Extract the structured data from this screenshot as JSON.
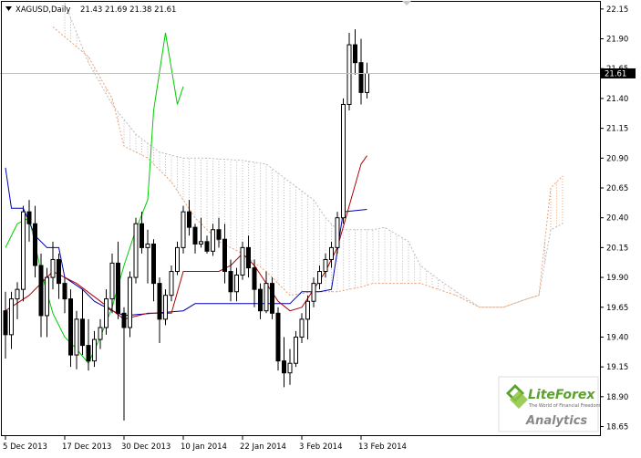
{
  "header": {
    "symbol": "XAGUSD,Daily",
    "ohlc": "21.43 21.69 21.38 21.61"
  },
  "price_label": "21.61",
  "brand": {
    "name": "LiteForex",
    "tagline": "The World of Financial Freedom",
    "product": "Analytics"
  },
  "colors": {
    "bull_candle": "#ffffff",
    "bear_candle": "#000000",
    "tenkan": "#b00000",
    "kijun": "#0000b0",
    "chikou": "#00cc00",
    "span_a": "#f0a070",
    "span_b": "#bbbbbb",
    "brand_green": "#5aa02c",
    "brand_blue": "#1f5fa8"
  },
  "chart_data": {
    "type": "candlestick",
    "title": "XAGUSD,Daily",
    "ylim": [
      18.57,
      22.21
    ],
    "y_ticks": [
      "22.15",
      "21.90",
      "21.65",
      "21.40",
      "21.15",
      "20.90",
      "20.65",
      "20.40",
      "20.15",
      "19.90",
      "19.65",
      "19.40",
      "19.15",
      "18.90",
      "18.65"
    ],
    "x_tick_labels": [
      "5 Dec 2013",
      "17 Dec 2013",
      "30 Dec 2013",
      "10 Jan 2014",
      "22 Jan 2014",
      "3 Feb 2014",
      "13 Feb 2014"
    ],
    "x_tick_index": [
      0,
      10,
      20,
      30,
      40,
      50,
      60
    ],
    "last_price": 21.61,
    "candles": [
      [
        19.62,
        19.78,
        19.22,
        19.42
      ],
      [
        19.42,
        19.78,
        19.3,
        19.72
      ],
      [
        19.72,
        19.86,
        19.55,
        19.8
      ],
      [
        19.8,
        20.5,
        19.7,
        20.45
      ],
      [
        20.45,
        20.55,
        20.2,
        20.35
      ],
      [
        20.35,
        20.5,
        19.9,
        20.0
      ],
      [
        20.0,
        20.1,
        19.4,
        19.58
      ],
      [
        19.58,
        19.98,
        19.4,
        19.9
      ],
      [
        19.9,
        20.2,
        19.8,
        20.05
      ],
      [
        20.05,
        20.1,
        19.72,
        19.85
      ],
      [
        19.85,
        19.9,
        19.6,
        19.72
      ],
      [
        19.72,
        19.8,
        19.15,
        19.25
      ],
      [
        19.25,
        19.62,
        19.13,
        19.55
      ],
      [
        19.55,
        19.8,
        19.25,
        19.33
      ],
      [
        19.33,
        19.55,
        19.12,
        19.2
      ],
      [
        19.2,
        19.45,
        19.15,
        19.38
      ],
      [
        19.38,
        19.55,
        19.3,
        19.48
      ],
      [
        19.48,
        19.8,
        19.42,
        19.72
      ],
      [
        19.72,
        20.1,
        19.6,
        20.02
      ],
      [
        20.02,
        20.2,
        19.55,
        19.6
      ],
      [
        19.6,
        19.65,
        18.7,
        19.48
      ],
      [
        19.48,
        19.95,
        19.4,
        19.9
      ],
      [
        19.9,
        20.4,
        19.85,
        20.35
      ],
      [
        20.35,
        20.45,
        20.1,
        20.15
      ],
      [
        20.15,
        20.3,
        19.85,
        20.18
      ],
      [
        20.18,
        20.22,
        19.7,
        19.85
      ],
      [
        19.85,
        19.9,
        19.35,
        19.55
      ],
      [
        19.55,
        19.8,
        19.5,
        19.75
      ],
      [
        19.75,
        20.0,
        19.7,
        19.95
      ],
      [
        19.95,
        20.2,
        19.92,
        20.15
      ],
      [
        20.15,
        20.5,
        20.1,
        20.45
      ],
      [
        20.45,
        20.55,
        20.25,
        20.32
      ],
      [
        20.32,
        20.35,
        20.1,
        20.18
      ],
      [
        20.18,
        20.4,
        20.15,
        20.2
      ],
      [
        20.2,
        20.25,
        20.1,
        20.12
      ],
      [
        20.12,
        20.35,
        20.08,
        20.3
      ],
      [
        20.3,
        20.4,
        20.15,
        20.22
      ],
      [
        20.22,
        20.35,
        19.85,
        19.95
      ],
      [
        19.95,
        20.05,
        19.7,
        19.78
      ],
      [
        19.78,
        19.98,
        19.7,
        19.92
      ],
      [
        19.92,
        20.2,
        19.88,
        20.15
      ],
      [
        20.15,
        20.25,
        19.9,
        19.98
      ],
      [
        19.98,
        20.05,
        19.65,
        19.8
      ],
      [
        19.8,
        19.85,
        19.55,
        19.62
      ],
      [
        19.62,
        19.95,
        19.6,
        19.85
      ],
      [
        19.85,
        19.9,
        19.55,
        19.6
      ],
      [
        19.6,
        19.65,
        19.12,
        19.2
      ],
      [
        19.2,
        19.4,
        18.98,
        19.1
      ],
      [
        19.1,
        19.3,
        19.0,
        19.18
      ],
      [
        19.18,
        19.45,
        19.15,
        19.4
      ],
      [
        19.4,
        19.6,
        19.35,
        19.55
      ],
      [
        19.55,
        19.75,
        19.38,
        19.7
      ],
      [
        19.7,
        19.9,
        19.65,
        19.85
      ],
      [
        19.85,
        20.0,
        19.8,
        19.95
      ],
      [
        19.95,
        20.1,
        19.9,
        20.05
      ],
      [
        20.05,
        20.2,
        19.98,
        20.15
      ],
      [
        20.15,
        20.45,
        20.1,
        20.4
      ],
      [
        20.4,
        21.4,
        20.35,
        21.35
      ],
      [
        21.35,
        21.95,
        21.3,
        21.85
      ],
      [
        21.85,
        21.98,
        21.6,
        21.7
      ],
      [
        21.7,
        21.9,
        21.35,
        21.45
      ],
      [
        21.45,
        21.7,
        21.4,
        21.61
      ]
    ],
    "tenkan_sen": [
      [
        0,
        19.62
      ],
      [
        4,
        19.75
      ],
      [
        8,
        19.95
      ],
      [
        12,
        19.85
      ],
      [
        16,
        19.7
      ],
      [
        20,
        19.55
      ],
      [
        24,
        19.6
      ],
      [
        28,
        19.6
      ],
      [
        30,
        19.95
      ],
      [
        36,
        19.95
      ],
      [
        38,
        20.0
      ],
      [
        40,
        20.1
      ],
      [
        42,
        20.0
      ],
      [
        44,
        19.85
      ],
      [
        46,
        19.7
      ],
      [
        48,
        19.62
      ],
      [
        50,
        19.65
      ],
      [
        52,
        19.8
      ],
      [
        54,
        19.95
      ],
      [
        56,
        20.15
      ],
      [
        58,
        20.5
      ],
      [
        60,
        20.85
      ],
      [
        61,
        20.92
      ]
    ],
    "kijun_sen": [
      [
        0,
        20.82
      ],
      [
        1,
        20.48
      ],
      [
        3,
        20.48
      ],
      [
        5,
        20.25
      ],
      [
        7,
        20.15
      ],
      [
        9,
        20.15
      ],
      [
        10,
        19.9
      ],
      [
        13,
        19.8
      ],
      [
        15,
        19.7
      ],
      [
        18,
        19.62
      ],
      [
        20,
        19.58
      ],
      [
        30,
        19.62
      ],
      [
        32,
        19.68
      ],
      [
        48,
        19.68
      ],
      [
        50,
        19.78
      ],
      [
        53,
        19.78
      ],
      [
        55,
        19.8
      ],
      [
        57,
        20.45
      ],
      [
        61,
        20.47
      ]
    ],
    "chikou_span": [
      [
        0,
        20.15
      ],
      [
        2,
        20.35
      ],
      [
        4,
        20.4
      ],
      [
        6,
        19.95
      ],
      [
        8,
        19.6
      ],
      [
        10,
        19.4
      ],
      [
        12,
        19.3
      ],
      [
        14,
        19.18
      ],
      [
        16,
        19.4
      ],
      [
        18,
        19.65
      ],
      [
        20,
        20.0
      ],
      [
        22,
        20.3
      ],
      [
        24,
        20.55
      ],
      [
        25,
        21.3
      ],
      [
        27,
        21.95
      ],
      [
        29,
        21.35
      ],
      [
        30,
        21.5
      ]
    ],
    "senkou_span_a": [
      [
        8,
        22.0
      ],
      [
        14,
        21.75
      ],
      [
        18,
        21.4
      ],
      [
        20,
        21.0
      ],
      [
        24,
        20.9
      ],
      [
        28,
        20.7
      ],
      [
        32,
        20.4
      ],
      [
        36,
        20.2
      ],
      [
        40,
        20.1
      ],
      [
        44,
        19.95
      ],
      [
        48,
        19.75
      ],
      [
        52,
        19.78
      ],
      [
        56,
        19.78
      ],
      [
        60,
        19.82
      ],
      [
        62,
        19.85
      ],
      [
        70,
        19.85
      ],
      [
        76,
        19.75
      ],
      [
        80,
        19.65
      ],
      [
        84,
        19.65
      ],
      [
        88,
        19.72
      ],
      [
        90,
        19.75
      ],
      [
        92,
        20.65
      ],
      [
        94,
        20.75
      ]
    ],
    "senkou_span_b": [
      [
        10,
        22.2
      ],
      [
        14,
        21.7
      ],
      [
        18,
        21.35
      ],
      [
        22,
        21.1
      ],
      [
        26,
        20.95
      ],
      [
        30,
        20.9
      ],
      [
        34,
        20.9
      ],
      [
        40,
        20.88
      ],
      [
        44,
        20.85
      ],
      [
        48,
        20.7
      ],
      [
        52,
        20.55
      ],
      [
        54,
        20.4
      ],
      [
        56,
        20.3
      ],
      [
        58,
        20.3
      ],
      [
        60,
        20.3
      ],
      [
        62,
        20.3
      ],
      [
        64,
        20.32
      ],
      [
        68,
        20.2
      ],
      [
        70,
        20.0
      ],
      [
        74,
        19.85
      ],
      [
        80,
        19.65
      ],
      [
        84,
        19.65
      ],
      [
        88,
        19.72
      ],
      [
        90,
        19.75
      ],
      [
        92,
        20.3
      ],
      [
        94,
        20.35
      ]
    ]
  }
}
